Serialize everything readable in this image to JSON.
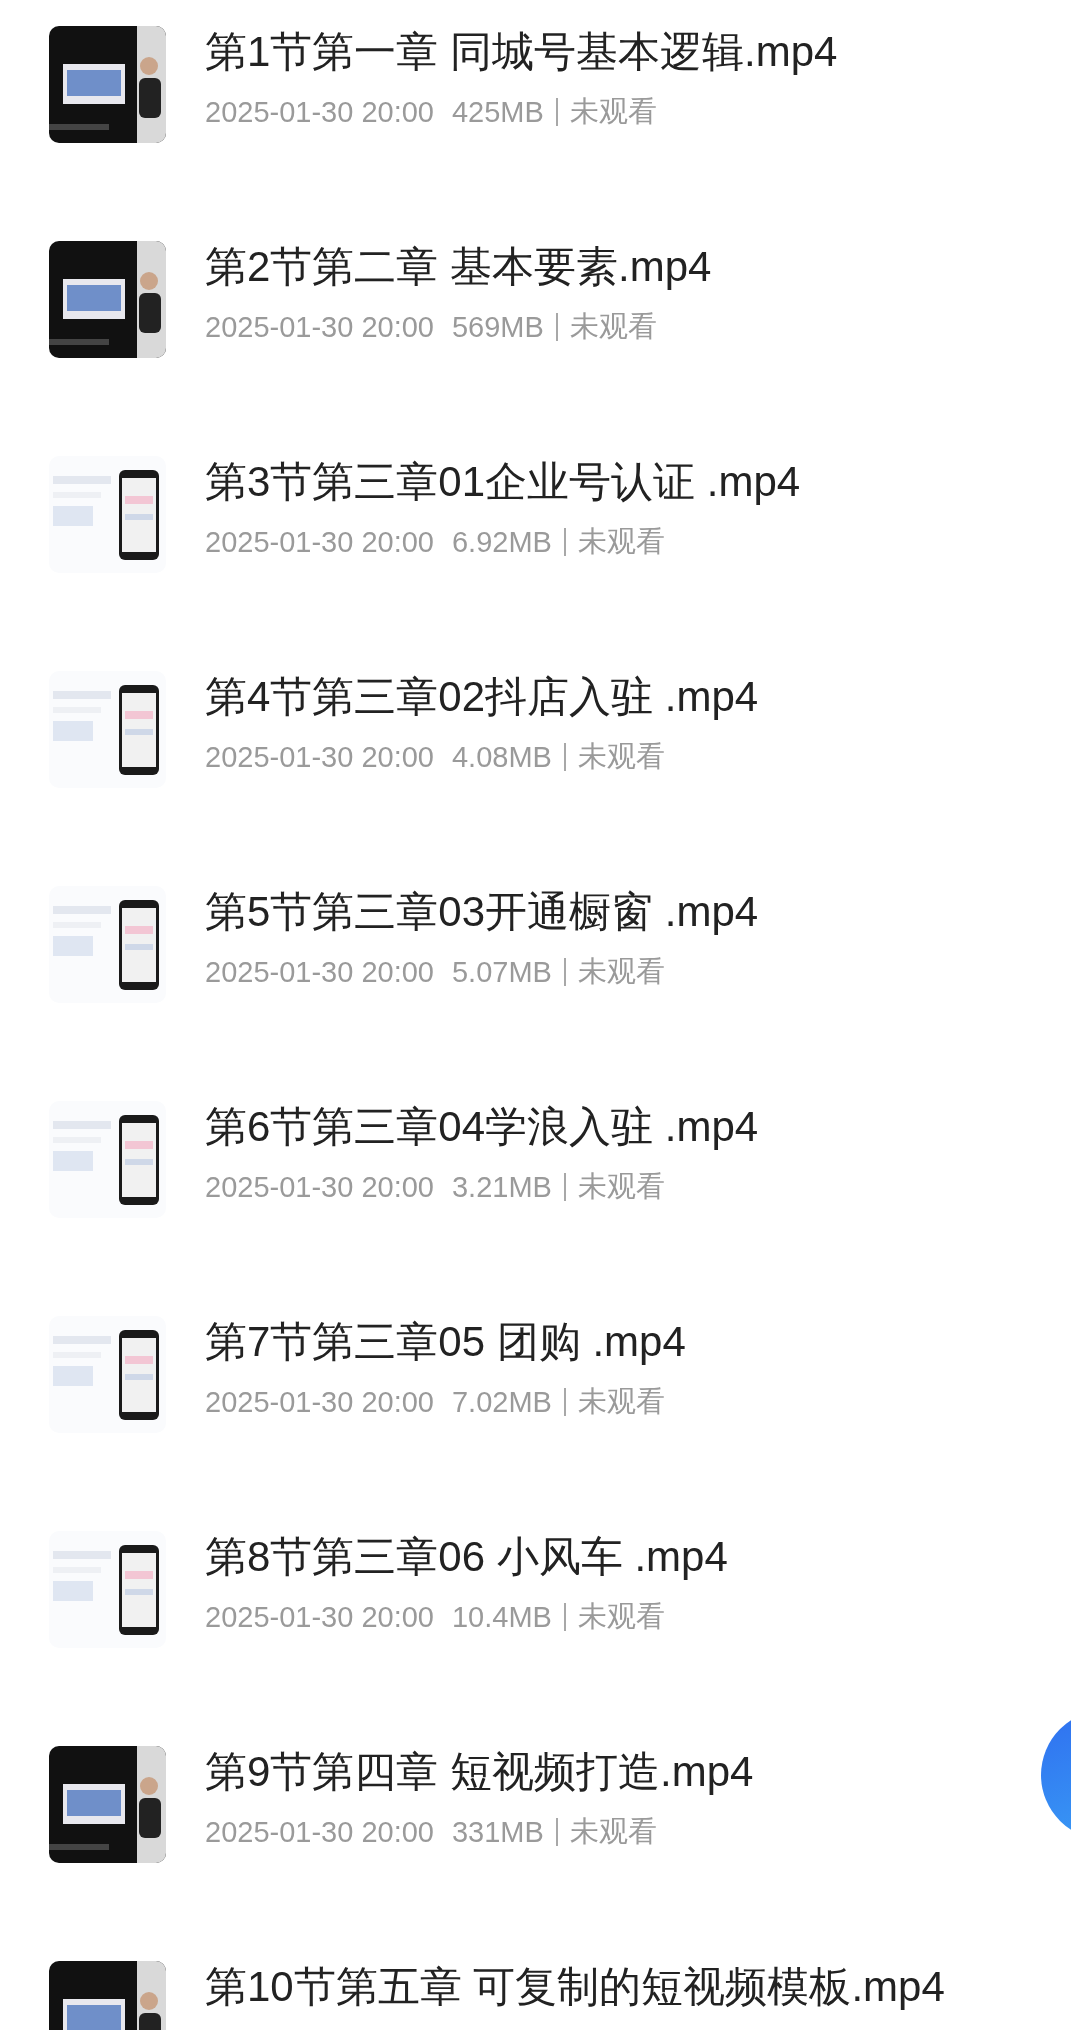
{
  "videos": [
    {
      "title": "第1节第一章 同城号基本逻辑.mp4",
      "date": "2025-01-30 20:00",
      "size": "425MB",
      "status": "未观看"
    },
    {
      "title": "第2节第二章 基本要素.mp4",
      "date": "2025-01-30 20:00",
      "size": "569MB",
      "status": "未观看"
    },
    {
      "title": "第3节第三章01企业号认证 .mp4",
      "date": "2025-01-30 20:00",
      "size": "6.92MB",
      "status": "未观看"
    },
    {
      "title": "第4节第三章02抖店入驻 .mp4",
      "date": "2025-01-30 20:00",
      "size": "4.08MB",
      "status": "未观看"
    },
    {
      "title": "第5节第三章03开通橱窗 .mp4",
      "date": "2025-01-30 20:00",
      "size": "5.07MB",
      "status": "未观看"
    },
    {
      "title": "第6节第三章04学浪入驻 .mp4",
      "date": "2025-01-30 20:00",
      "size": "3.21MB",
      "status": "未观看"
    },
    {
      "title": "第7节第三章05 团购 .mp4",
      "date": "2025-01-30 20:00",
      "size": "7.02MB",
      "status": "未观看"
    },
    {
      "title": "第8节第三章06 小风车 .mp4",
      "date": "2025-01-30 20:00",
      "size": "10.4MB",
      "status": "未观看"
    },
    {
      "title": "第9节第四章 短视频打造.mp4",
      "date": "2025-01-30 20:00",
      "size": "331MB",
      "status": "未观看"
    },
    {
      "title": "第10节第五章 可复制的短视频模板.mp4"
    }
  ],
  "floating_button": {
    "kind": "button"
  }
}
